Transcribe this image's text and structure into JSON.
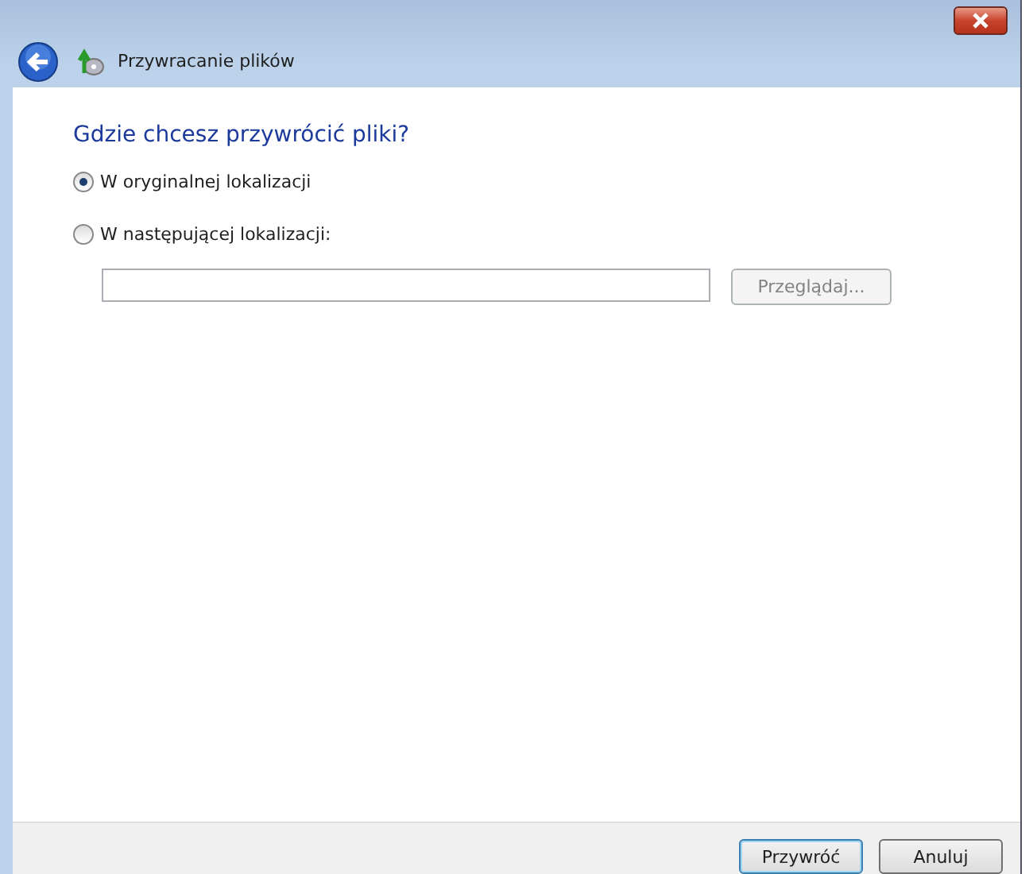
{
  "window": {
    "title": "Przywracanie plików"
  },
  "heading": "Gdzie chcesz przywrócić pliki?",
  "options": [
    {
      "label": "W oryginalnej lokalizacji",
      "selected": true
    },
    {
      "label": "W następującej lokalizacji:",
      "selected": false
    }
  ],
  "browse_button": {
    "label": "Przeglądaj...",
    "disabled": true
  },
  "buttons": [
    {
      "label": "Przywróć",
      "default": true
    },
    {
      "label": "Anuluj",
      "default": false
    }
  ]
}
